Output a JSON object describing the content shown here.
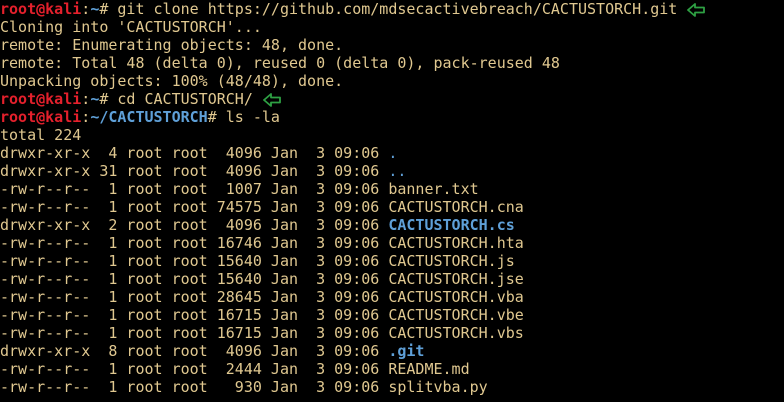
{
  "prompt": {
    "user_host": "root@kali",
    "home": "~",
    "project_path": "~/CACTUSTORCH",
    "symbol": "#"
  },
  "commands": {
    "clone": "git clone https://github.com/mdsecactivebreach/CACTUSTORCH.git",
    "cd": "cd CACTUSTORCH/",
    "ls": "ls -la"
  },
  "clone_output": [
    "Cloning into 'CACTUSTORCH'...",
    "remote: Enumerating objects: 48, done.",
    "remote: Total 48 (delta 0), reused 0 (delta 0), pack-reused 48",
    "Unpacking objects: 100% (48/48), done."
  ],
  "total_line": "total 224",
  "listing": [
    {
      "perms": "drwxr-xr-x",
      "links": " 4",
      "owner": "root",
      "group": "root",
      "size": " 4096",
      "month": "Jan",
      "day": " 3",
      "time": "09:06",
      "name": ".",
      "kind": "dir"
    },
    {
      "perms": "drwxr-xr-x",
      "links": "31",
      "owner": "root",
      "group": "root",
      "size": " 4096",
      "month": "Jan",
      "day": " 3",
      "time": "09:06",
      "name": "..",
      "kind": "dir"
    },
    {
      "perms": "-rw-r--r--",
      "links": " 1",
      "owner": "root",
      "group": "root",
      "size": " 1007",
      "month": "Jan",
      "day": " 3",
      "time": "09:06",
      "name": "banner.txt",
      "kind": "file"
    },
    {
      "perms": "-rw-r--r--",
      "links": " 1",
      "owner": "root",
      "group": "root",
      "size": "74575",
      "month": "Jan",
      "day": " 3",
      "time": "09:06",
      "name": "CACTUSTORCH.cna",
      "kind": "file"
    },
    {
      "perms": "drwxr-xr-x",
      "links": " 2",
      "owner": "root",
      "group": "root",
      "size": " 4096",
      "month": "Jan",
      "day": " 3",
      "time": "09:06",
      "name": "CACTUSTORCH.cs",
      "kind": "dir-bold"
    },
    {
      "perms": "-rw-r--r--",
      "links": " 1",
      "owner": "root",
      "group": "root",
      "size": "16746",
      "month": "Jan",
      "day": " 3",
      "time": "09:06",
      "name": "CACTUSTORCH.hta",
      "kind": "file"
    },
    {
      "perms": "-rw-r--r--",
      "links": " 1",
      "owner": "root",
      "group": "root",
      "size": "15640",
      "month": "Jan",
      "day": " 3",
      "time": "09:06",
      "name": "CACTUSTORCH.js",
      "kind": "file"
    },
    {
      "perms": "-rw-r--r--",
      "links": " 1",
      "owner": "root",
      "group": "root",
      "size": "15640",
      "month": "Jan",
      "day": " 3",
      "time": "09:06",
      "name": "CACTUSTORCH.jse",
      "kind": "file"
    },
    {
      "perms": "-rw-r--r--",
      "links": " 1",
      "owner": "root",
      "group": "root",
      "size": "28645",
      "month": "Jan",
      "day": " 3",
      "time": "09:06",
      "name": "CACTUSTORCH.vba",
      "kind": "file"
    },
    {
      "perms": "-rw-r--r--",
      "links": " 1",
      "owner": "root",
      "group": "root",
      "size": "16715",
      "month": "Jan",
      "day": " 3",
      "time": "09:06",
      "name": "CACTUSTORCH.vbe",
      "kind": "file"
    },
    {
      "perms": "-rw-r--r--",
      "links": " 1",
      "owner": "root",
      "group": "root",
      "size": "16715",
      "month": "Jan",
      "day": " 3",
      "time": "09:06",
      "name": "CACTUSTORCH.vbs",
      "kind": "file"
    },
    {
      "perms": "drwxr-xr-x",
      "links": " 8",
      "owner": "root",
      "group": "root",
      "size": " 4096",
      "month": "Jan",
      "day": " 3",
      "time": "09:06",
      "name": ".git",
      "kind": "dir-bold"
    },
    {
      "perms": "-rw-r--r--",
      "links": " 1",
      "owner": "root",
      "group": "root",
      "size": " 2444",
      "month": "Jan",
      "day": " 3",
      "time": "09:06",
      "name": "README.md",
      "kind": "file"
    },
    {
      "perms": "-rw-r--r--",
      "links": " 1",
      "owner": "root",
      "group": "root",
      "size": "  930",
      "month": "Jan",
      "day": " 3",
      "time": "09:06",
      "name": "splitvba.py",
      "kind": "file"
    }
  ],
  "colors": {
    "background": "#000000",
    "text": "#e0c890",
    "prompt_user": "#e4202c",
    "path": "#5fa0d8",
    "arrow": "#2ea043"
  },
  "icons": {
    "annotation_arrow": "left-arrow-icon"
  }
}
